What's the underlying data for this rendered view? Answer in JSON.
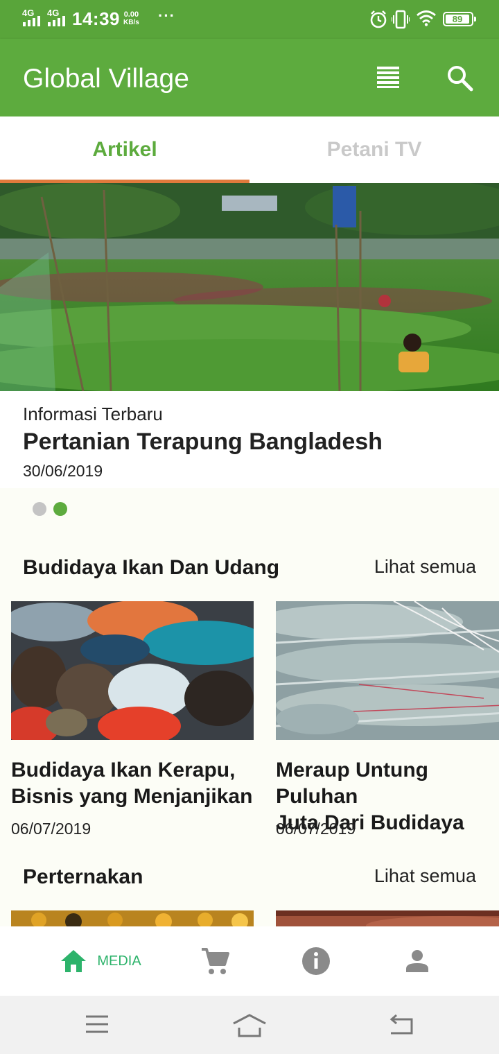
{
  "status_bar": {
    "sim1": "4G",
    "sim2": "4G",
    "time": "14:39",
    "net_speed_value": "0.00",
    "net_speed_unit": "KB/s",
    "more": "···",
    "battery": "89",
    "icons": [
      "alarm-icon",
      "vibrate-icon",
      "wifi-icon",
      "battery-icon"
    ]
  },
  "app_bar": {
    "title": "Global Village",
    "actions": [
      "list-view-icon",
      "search-icon"
    ]
  },
  "tabs": [
    {
      "label": "Artikel",
      "active": true
    },
    {
      "label": "Petani TV",
      "active": false
    }
  ],
  "hero": {
    "kicker": "Informasi Terbaru",
    "title": "Pertanian Terapung Bangladesh",
    "date": "30/06/2019",
    "pager_count": 2,
    "pager_active": 1
  },
  "sections": [
    {
      "title": "Budidaya Ikan Dan Udang",
      "see_all": "Lihat semua",
      "cards": [
        {
          "title": "Budidaya Ikan Kerapu,\nBisnis yang Menjanjikan",
          "date": "06/07/2019"
        },
        {
          "title": "Meraup Untung Puluhan\nJuta Dari Budidaya",
          "date": "06/07/2019"
        }
      ]
    },
    {
      "title": "Perternakan",
      "see_all": "Lihat semua"
    }
  ],
  "bottom_nav": [
    {
      "label": "MEDIA",
      "icon": "home-icon",
      "active": true
    },
    {
      "label": "",
      "icon": "cart-icon",
      "active": false
    },
    {
      "label": "",
      "icon": "info-icon",
      "active": false
    },
    {
      "label": "",
      "icon": "person-icon",
      "active": false
    }
  ],
  "colors": {
    "primary": "#5dab3e",
    "status_bar": "#59a53a",
    "tab_indicator": "#e07a3c",
    "nav_active": "#2db36b",
    "nav_inactive": "#8a8a8a"
  }
}
